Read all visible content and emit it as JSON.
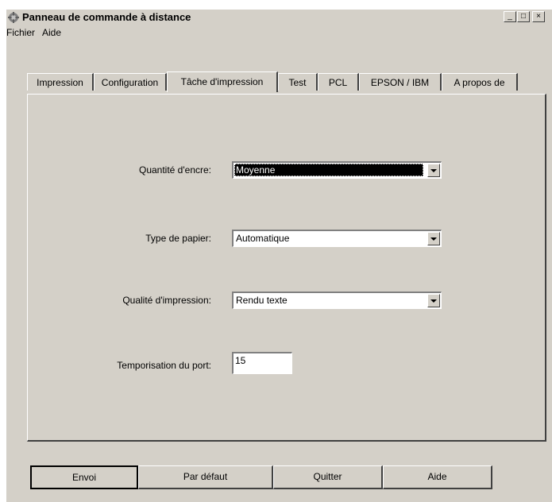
{
  "window": {
    "title": "Panneau de commande à distance",
    "controls": {
      "minimize": "_",
      "maximize": "□",
      "close": "×"
    }
  },
  "menu": [
    "Fichier",
    "Aide"
  ],
  "tabs": [
    {
      "label": "Impression"
    },
    {
      "label": "Configuration"
    },
    {
      "label": "Tâche d'impression",
      "active": true
    },
    {
      "label": "Test"
    },
    {
      "label": "PCL"
    },
    {
      "label": "EPSON / IBM"
    },
    {
      "label": "A propos de"
    }
  ],
  "form": {
    "ink": {
      "label": "Quantité d'encre:",
      "value": "Moyenne"
    },
    "paper": {
      "label": "Type de papier:",
      "value": "Automatique"
    },
    "quality": {
      "label": "Qualité d'impression:",
      "value": "Rendu texte"
    },
    "timeout": {
      "label": "Temporisation du port:",
      "value": "15"
    }
  },
  "buttons": {
    "send": "Envoi",
    "default": "Par défaut",
    "quit": "Quitter",
    "help": "Aide"
  }
}
